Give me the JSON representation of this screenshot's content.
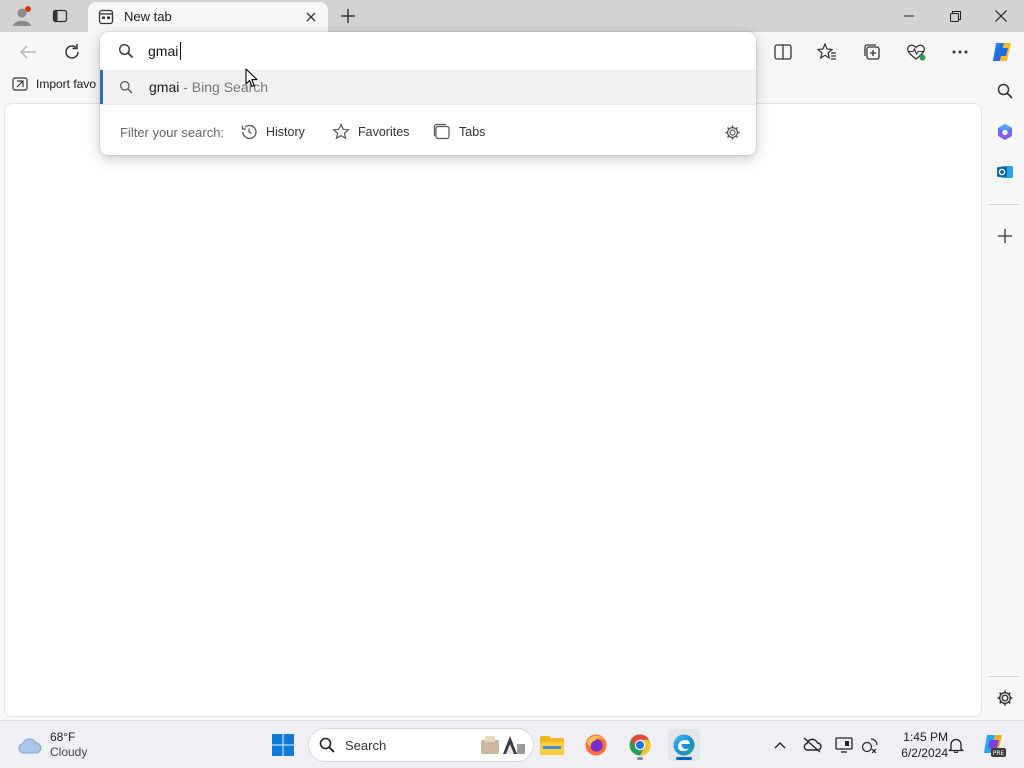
{
  "browser": {
    "tab": {
      "title": "New tab"
    },
    "favorites_bar": {
      "import_label": "Import favo"
    },
    "address_dropdown": {
      "query": "gmai",
      "suggestion": {
        "query": "gmai",
        "hint": " - Bing Search"
      },
      "filter_label": "Filter your search:",
      "filters": [
        {
          "label": "History",
          "icon": "history-icon"
        },
        {
          "label": "Favorites",
          "icon": "star-icon"
        },
        {
          "label": "Tabs",
          "icon": "tabs-icon"
        }
      ]
    }
  },
  "taskbar": {
    "weather": {
      "temp": "68°F",
      "condition": "Cloudy"
    },
    "search_placeholder": "Search",
    "clock": {
      "time": "1:45 PM",
      "date": "6/2/2024"
    }
  },
  "colors": {
    "accent": "#0067c0",
    "selection_bar": "#2f6fbf",
    "profile_dot": "#d83b01",
    "chrome_bg": "#d3d3d3"
  }
}
